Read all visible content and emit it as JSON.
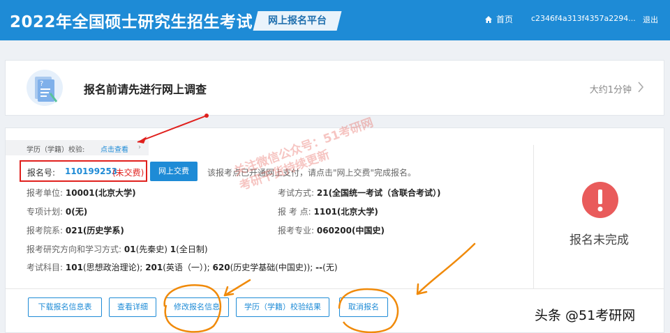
{
  "header": {
    "title": "2022年全国硕士研究生招生考试",
    "platform": "网上报名平台",
    "home": "首页",
    "user": "c2346f4a313f4357a2294...",
    "logout": "退出"
  },
  "survey": {
    "title": "报名前请先进行网上调查",
    "time": "大约1分钟"
  },
  "verify": {
    "label": "学历（学籍）校验:",
    "link": "点击查看"
  },
  "registration": {
    "no_label": "报名号:",
    "no_value": "110199253",
    "status": "(未交费)",
    "pay_button": "网上交费",
    "pay_note": "该报考点已开通网上支付，请点击\"网上交费\"完成报名。"
  },
  "fields": {
    "unit_label": "报考单位:",
    "unit_value": "10001(北京大学)",
    "plan_label": "专项计划:",
    "plan_value": "0(无)",
    "dept_label": "报考院系:",
    "dept_value": "021(历史学系)",
    "direction_label": "报考研究方向和学习方式:",
    "direction_code": "01",
    "direction_name": "(先秦史)",
    "mode_code": "1",
    "mode_name": "(全日制)",
    "exam_mode_label": "考试方式:",
    "exam_mode_value": "21(全国统一考试（含联合考试）)",
    "site_label": "报 考 点:",
    "site_value": "1101(北京大学)",
    "major_label": "报考专业:",
    "major_value": "060200(中国史)",
    "subjects_label": "考试科目:",
    "s1_code": "101",
    "s1_name": "(思想政治理论);",
    "s2_code": "201",
    "s2_name": "(英语（一）);",
    "s3_code": "620",
    "s3_name": "(历史学基础(中国史));",
    "s4_code": "--",
    "s4_name": "(无)"
  },
  "status": {
    "text": "报名未完成",
    "color": "#e95b5b"
  },
  "buttons": {
    "download": "下载报名信息表",
    "details": "查看详细",
    "edit": "修改报名信息",
    "verify_result": "学历（学籍）校验结果",
    "cancel": "取消报名"
  },
  "watermark": {
    "line1": "关注微信公众号：51考研网",
    "line2": "考研干货持续更新"
  },
  "credit": "头条 @51考研网",
  "colors": {
    "primary": "#1e8bd6",
    "danger": "#e0201d",
    "annotation": "#f08a0a"
  }
}
